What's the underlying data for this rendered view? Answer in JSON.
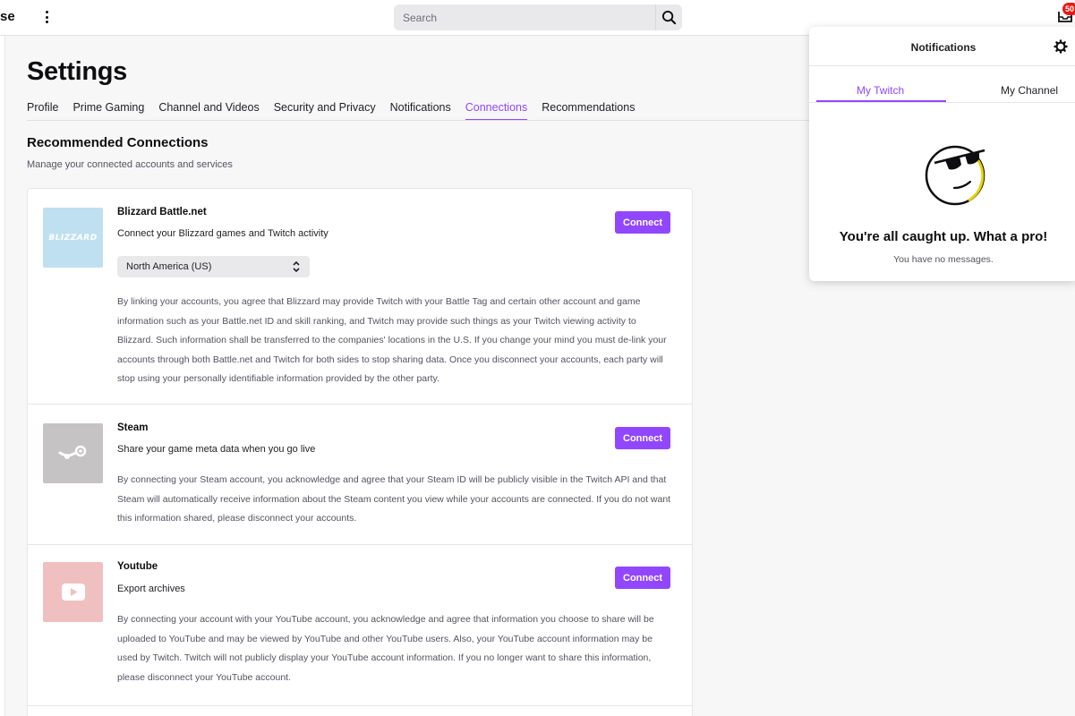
{
  "topbar": {
    "browse_label": "se",
    "search_placeholder": "Search",
    "inbox_badge": "50"
  },
  "settings": {
    "title": "Settings",
    "tabs": [
      {
        "label": "Profile"
      },
      {
        "label": "Prime Gaming"
      },
      {
        "label": "Channel and Videos"
      },
      {
        "label": "Security and Privacy"
      },
      {
        "label": "Notifications"
      },
      {
        "label": "Connections"
      },
      {
        "label": "Recommendations"
      }
    ],
    "active_tab": "Connections",
    "section_title": "Recommended Connections",
    "section_subtitle": "Manage your connected accounts and services"
  },
  "connections": [
    {
      "name": "Blizzard Battle.net",
      "description": "Connect your Blizzard games and Twitch activity",
      "button_label": "Connect",
      "logo_text": "BLIZZARD",
      "logo_color": "#bfe0f0",
      "region_selected": "North America (US)",
      "legal": "By linking your accounts, you agree that Blizzard may provide Twitch with your Battle Tag and certain other account and game information such as your Battle.net ID and skill ranking, and Twitch may provide such things as your Twitch viewing activity to Blizzard. Such information shall be transferred to the companies' locations in the U.S. If you change your mind you must de-link your accounts through both Battle.net and Twitch for both sides to stop sharing data. Once you disconnect your accounts, each party will stop using your personally identifiable information provided by the other party."
    },
    {
      "name": "Steam",
      "description": "Share your game meta data when you go live",
      "button_label": "Connect",
      "logo_color": "#c5c3c4",
      "legal": "By connecting your Steam account, you acknowledge and agree that your Steam ID will be publicly visible in the Twitch API and that Steam will automatically receive information about the Steam content you view while your accounts are connected. If you do not want this information shared, please disconnect your accounts."
    },
    {
      "name": "Youtube",
      "description": "Export archives",
      "button_label": "Connect",
      "logo_color": "#f0c0c0",
      "legal": "By connecting your account with your YouTube account, you acknowledge and agree that information you choose to share will be uploaded to YouTube and may be viewed by YouTube and other YouTube users. Also, your YouTube account information may be used by Twitch. Twitch will not publicly display your YouTube account information. If you no longer want to share this information, please disconnect your YouTube account."
    }
  ],
  "notifications": {
    "title": "Notifications",
    "tabs": [
      {
        "label": "My Twitch"
      },
      {
        "label": "My Channel"
      }
    ],
    "active_tab": "My Twitch",
    "empty_title": "You're all caught up. What a pro!",
    "empty_subtitle": "You have no messages."
  },
  "colors": {
    "accent": "#9147ff",
    "badge": "#e91916"
  }
}
